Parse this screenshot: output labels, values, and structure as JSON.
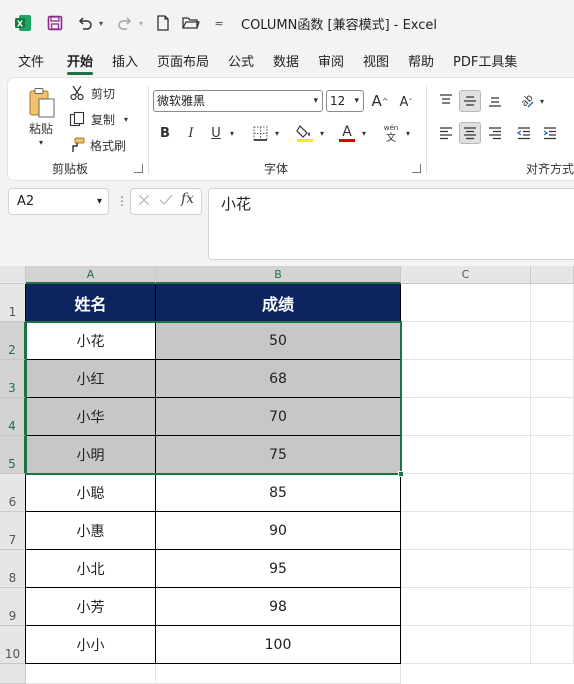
{
  "titlebar": {
    "title": "COLUMN函数  [兼容模式]  -  Excel"
  },
  "tabs": [
    "文件",
    "开始",
    "插入",
    "页面布局",
    "公式",
    "数据",
    "审阅",
    "视图",
    "帮助",
    "PDF工具集"
  ],
  "active_tab": "开始",
  "ribbon": {
    "clipboard": {
      "paste": "粘贴",
      "cut": "剪切",
      "copy": "复制",
      "format_painter": "格式刷",
      "label": "剪贴板"
    },
    "font": {
      "font_name": "微软雅黑",
      "font_size": "12",
      "bold": "B",
      "italic": "I",
      "underline": "U",
      "phonetic": "wén",
      "label": "字体"
    },
    "alignment": {
      "label": "对齐方式"
    }
  },
  "formula_bar": {
    "name_box": "A2",
    "fx": "fx",
    "content": "小花"
  },
  "columns": [
    "A",
    "B",
    "C"
  ],
  "rows": [
    "1",
    "2",
    "3",
    "4",
    "5",
    "6",
    "7",
    "8",
    "9",
    "10"
  ],
  "table": {
    "headers": [
      "姓名",
      "成绩"
    ],
    "records": [
      [
        "小花",
        "50"
      ],
      [
        "小红",
        "68"
      ],
      [
        "小华",
        "70"
      ],
      [
        "小明",
        "75"
      ],
      [
        "小聪",
        "85"
      ],
      [
        "小惠",
        "90"
      ],
      [
        "小北",
        "95"
      ],
      [
        "小芳",
        "98"
      ],
      [
        "小小",
        "100"
      ]
    ]
  },
  "colors": {
    "excel_green": "#1f7244",
    "header_fill": "#0d2461",
    "selected_fill": "#c7c7c7"
  }
}
